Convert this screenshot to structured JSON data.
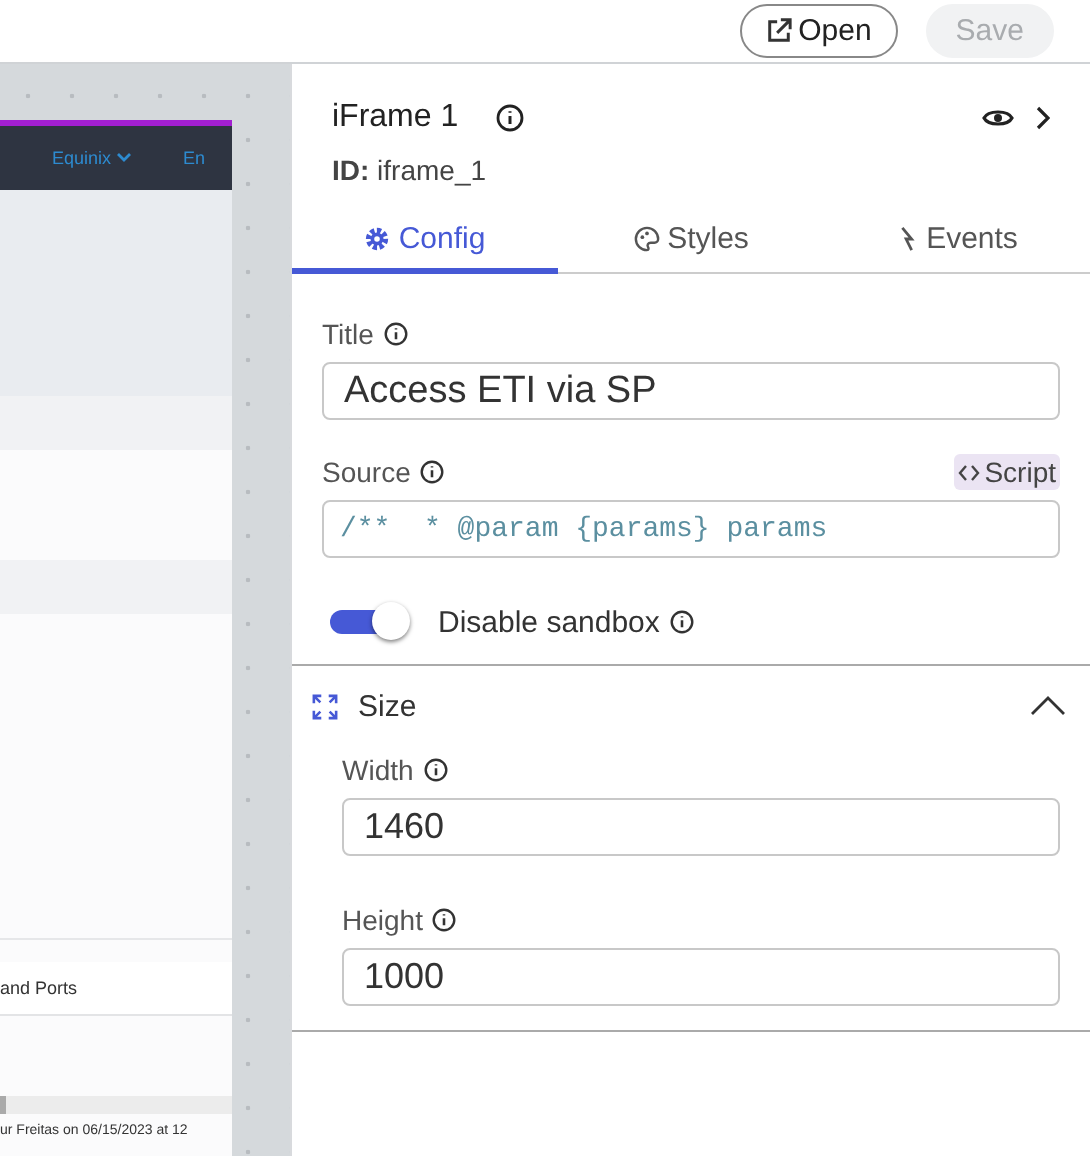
{
  "toolbar": {
    "buttons": [
      {
        "label": "Open",
        "disabled": false
      },
      {
        "label": "Save",
        "disabled": true
      }
    ]
  },
  "preview": {
    "nav_items": [
      {
        "label": "Equinix",
        "has_menu": true
      },
      {
        "label": "En",
        "has_menu": false
      }
    ],
    "table_header": "and Ports",
    "footer": "ur Freitas on 06/15/2023 at 12"
  },
  "panel": {
    "title": "iFrame 1",
    "id_label": "ID:",
    "id_value": "iframe_1",
    "tabs": [
      {
        "label": "Config",
        "selected": true
      },
      {
        "label": "Styles",
        "selected": false
      },
      {
        "label": "Events",
        "selected": false
      }
    ],
    "title_field": {
      "label": "Title",
      "value": "Access ETI via SP"
    },
    "source_field": {
      "label": "Source",
      "badge": "Script",
      "value": "/**  * @param {params} params"
    },
    "toggle": {
      "label": "Disable sandbox",
      "on": true
    },
    "size_section": {
      "title": "Size",
      "expanded": true,
      "fields": [
        {
          "label": "Width",
          "value": "1460"
        },
        {
          "label": "Height",
          "value": "1000"
        }
      ]
    }
  }
}
